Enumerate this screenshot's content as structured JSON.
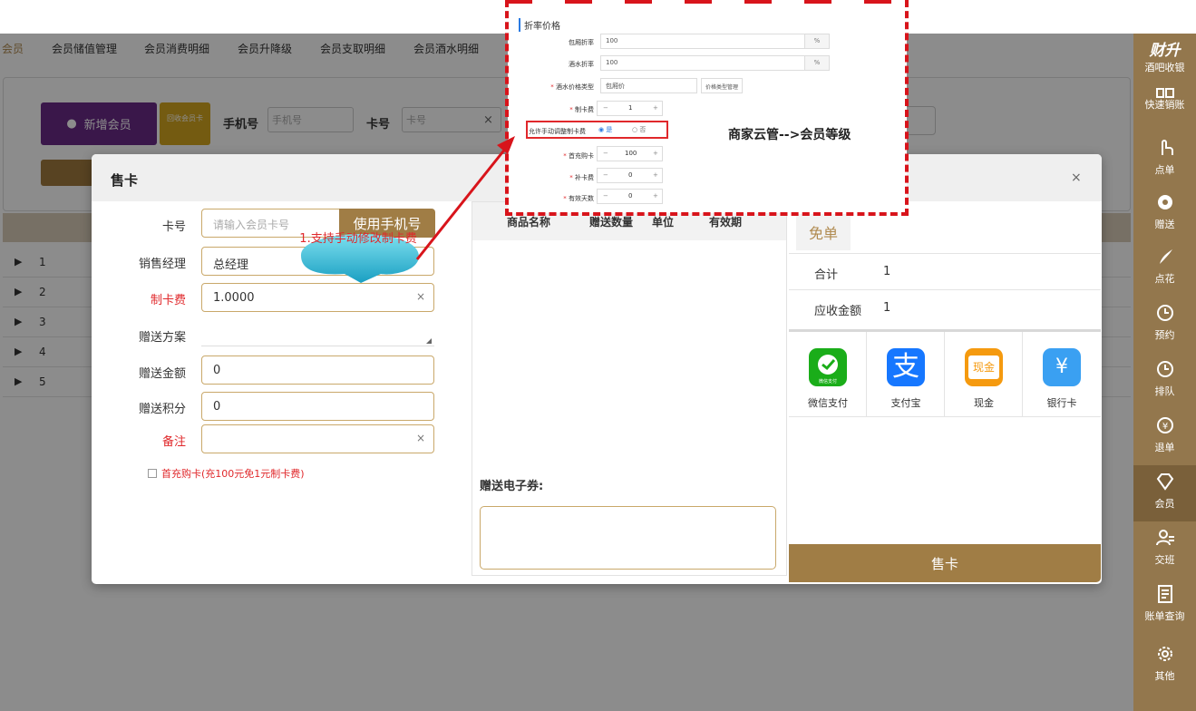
{
  "nav": {
    "tabs": [
      "会员",
      "会员储值管理",
      "会员消费明细",
      "会员升降级",
      "会员支取明细",
      "会员酒水明细"
    ]
  },
  "member_page": {
    "new_member_label": "新增会员",
    "recycle_label": "回收会员卡",
    "phone_label": "手机号",
    "phone_placeholder": "手机号",
    "card_label": "卡号",
    "card_placeholder": "卡号",
    "clear_label": "空",
    "rows": [
      "1",
      "2",
      "3",
      "4",
      "5"
    ]
  },
  "sidebar": {
    "brand": "财升",
    "brand_sub": "酒吧收银",
    "items": [
      "快速销账",
      "点单",
      "赠送",
      "点花",
      "预约",
      "排队",
      "退单",
      "会员",
      "交班",
      "账单查询",
      "其他"
    ]
  },
  "modal": {
    "title": "售卡",
    "close": "×",
    "card_no_label": "卡号",
    "card_no_placeholder": "请输入会员卡号",
    "use_phone_label": "使用手机号",
    "sales_manager_label": "销售经理",
    "sales_manager_value": "总经理",
    "card_fee_label": "制卡费",
    "card_fee_value": "1.0000",
    "gift_plan_label": "赠送方案",
    "gift_amount_label": "赠送金额",
    "gift_amount_value": "0",
    "gift_points_label": "赠送积分",
    "gift_points_value": "0",
    "remark_label": "备注",
    "first_charge_label": "首充购卡(充100元免1元制卡费)",
    "goods_columns": [
      "商品名称",
      "赠送数量",
      "单位",
      "有效期"
    ],
    "ecoupon_label": "赠送电子券:",
    "free_label": "免单",
    "total_label": "合计",
    "total_value": "1",
    "due_label": "应收金额",
    "due_value": "1",
    "payments": [
      {
        "label": "微信支付",
        "icon": "wechat-pay-icon",
        "color": "#1aad19",
        "glyph": "微信支付"
      },
      {
        "label": "支付宝",
        "icon": "alipay-icon",
        "color": "#1677ff",
        "glyph": "支"
      },
      {
        "label": "现金",
        "icon": "cash-icon",
        "color": "#f59a0f",
        "glyph": "现金"
      },
      {
        "label": "银行卡",
        "icon": "bank-card-icon",
        "color": "#3aa0f2",
        "glyph": "¥"
      }
    ],
    "sell_label": "售卡"
  },
  "settings": {
    "section_title": "折率价格",
    "room_discount_label": "包厢折率",
    "room_discount_value": "100",
    "drink_discount_label": "酒水折率",
    "drink_discount_value": "100",
    "percent": "%",
    "price_type_label": "酒水价格类型",
    "price_type_value": "包厢价",
    "price_manage_label": "价格类型管理",
    "card_fee_label": "制卡费",
    "card_fee_value": "1",
    "allow_adjust_label": "允许手动调整制卡费",
    "yes_label": "是",
    "no_label": "否",
    "first_charge_label": "首充购卡",
    "first_charge_value": "100",
    "reissue_label": "补卡费",
    "reissue_value": "0",
    "valid_days_label": "有效天数",
    "valid_days_value": "0",
    "minus": "−",
    "plus": "+",
    "path_note": "商家云管-->会员等级"
  },
  "callout": {
    "text": "1.支持手动修改制卡费"
  }
}
